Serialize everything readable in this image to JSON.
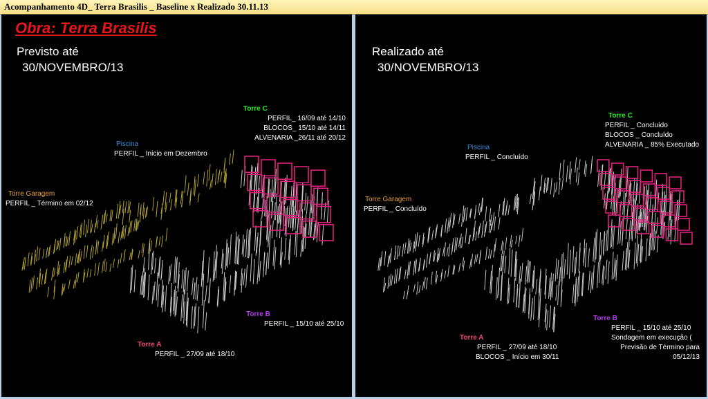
{
  "window_title": "Acompanhamento 4D_ Terra Brasilis _ Baseline x Realizado 30.11.13",
  "colors": {
    "background": "#000000",
    "frame": "#b9cfe6",
    "title_bar": "#f6e08a",
    "obra_title": "#e8161c",
    "torre_garagem": "#e8a23c",
    "piscina": "#3d8fe3",
    "torre_c": "#2ee82e",
    "torre_b": "#b63bf0",
    "torre_a": "#f04a78",
    "structure_done": "#c8c8c8",
    "structure_planned": "#b0a032",
    "masonry": "#e0207a"
  },
  "left": {
    "obra_title": "Obra: Terra Brasilis",
    "heading_line1": "Previsto até",
    "heading_line2": "30/NOVEMBRO/13",
    "torre_garagem": {
      "label": "Torre Garagem",
      "lines": [
        "PERFIL  _  Término em 02/12"
      ]
    },
    "piscina": {
      "label": "Piscina",
      "lines": [
        "PERFIL _ Inicio em Dezembro"
      ]
    },
    "torre_c": {
      "label": "Torre C",
      "lines": [
        "PERFIL_ 16/09 até 14/10",
        "BLOCOS_ 15/10 até 14/11",
        "ALVENARIA _26/11 até 20/12"
      ]
    },
    "torre_b": {
      "label": "Torre B",
      "lines": [
        "PERFIL _ 15/10 até 25/10"
      ]
    },
    "torre_a": {
      "label": "Torre A",
      "lines": [
        "PERFIL _ 27/09 até 18/10"
      ]
    }
  },
  "right": {
    "heading_line1": "Realizado até",
    "heading_line2": "30/NOVEMBRO/13",
    "torre_garagem": {
      "label": "Torre Garagem",
      "lines": [
        "PERFIL _ Concluído"
      ]
    },
    "piscina": {
      "label": "Piscina",
      "lines": [
        "PERFIL _ Concluído"
      ]
    },
    "torre_c": {
      "label": "Torre C",
      "lines": [
        "PERFIL _ Concluído",
        "BLOCOS _ Concluído",
        "ALVENARIA _ 85% Executado"
      ]
    },
    "torre_b": {
      "label": "Torre B",
      "lines": [
        "PERFIL _ 15/10 até 25/10",
        "Sondagem em execução (",
        "Previsão de Término para",
        "05/12/13"
      ]
    },
    "torre_a": {
      "label": "Torre A",
      "lines": [
        "PERFIL _ 27/09 até 18/10",
        "BLOCOS _ Início em 30/11"
      ]
    }
  }
}
